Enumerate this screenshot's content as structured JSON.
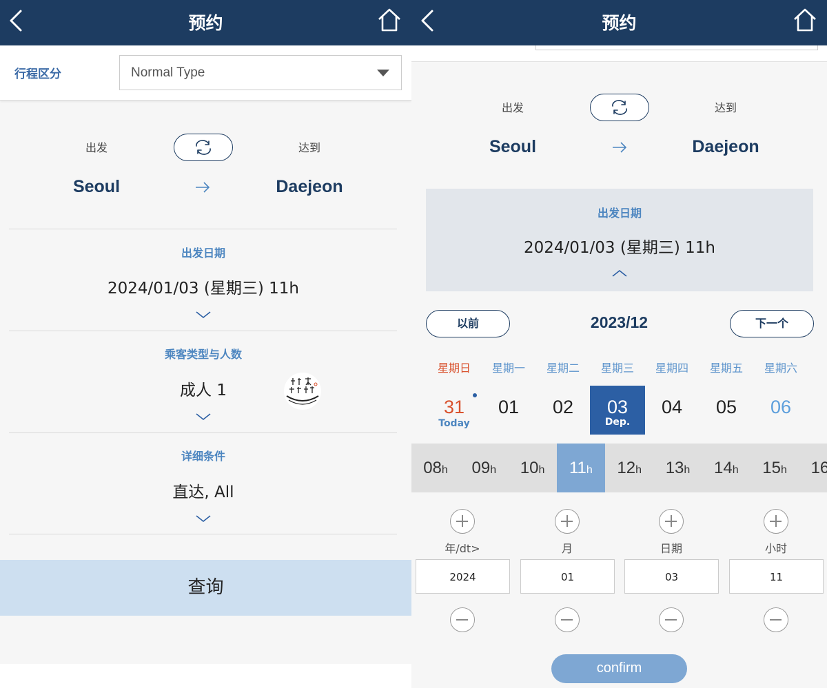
{
  "left": {
    "header_title": "预约",
    "trip_type_label": "行程区分",
    "trip_type_value": "Normal Type",
    "depart_label": "出发",
    "arrive_label": "达到",
    "origin": "Seoul",
    "destination": "Daejeon",
    "date_title": "出发日期",
    "date_value": "2024/01/03 (星期三) 11h",
    "passenger_title": "乘客类型与人数",
    "passenger_value": "成人 1",
    "detail_title": "详细条件",
    "detail_value": "直达, All",
    "query_label": "查询"
  },
  "right": {
    "header_title": "预约",
    "depart_label": "出发",
    "arrive_label": "达到",
    "origin": "Seoul",
    "destination": "Daejeon",
    "date_title": "出发日期",
    "date_value": "2024/01/03 (星期三) 11h",
    "prev_label": "以前",
    "next_label": "下一个",
    "month_label": "2023/12",
    "weekdays": [
      "星期日",
      "星期一",
      "星期二",
      "星期三",
      "星期四",
      "星期五",
      "星期六"
    ],
    "days": [
      {
        "num": "31",
        "sub": "Today"
      },
      {
        "num": "01",
        "sub": ""
      },
      {
        "num": "02",
        "sub": ""
      },
      {
        "num": "03",
        "sub": "Dep."
      },
      {
        "num": "04",
        "sub": ""
      },
      {
        "num": "05",
        "sub": ""
      },
      {
        "num": "06",
        "sub": ""
      }
    ],
    "hours": [
      "08",
      "09",
      "10",
      "11",
      "12",
      "13",
      "14",
      "15",
      "16"
    ],
    "hour_unit": "h",
    "fields": [
      {
        "label": "年/dt>",
        "value": "2024"
      },
      {
        "label": "月",
        "value": "01"
      },
      {
        "label": "日期",
        "value": "03"
      },
      {
        "label": "小时",
        "value": "11"
      }
    ],
    "confirm_label": "confirm"
  },
  "colors": {
    "header_bg": "#1d3c61",
    "accent_blue": "#4d86c0",
    "selected_day_bg": "#2c5fa4",
    "selected_hour_bg": "#7ea7d3",
    "sunday_red": "#d9522e",
    "saturday_blue": "#5d9fdc",
    "query_bg": "#cddff0"
  }
}
